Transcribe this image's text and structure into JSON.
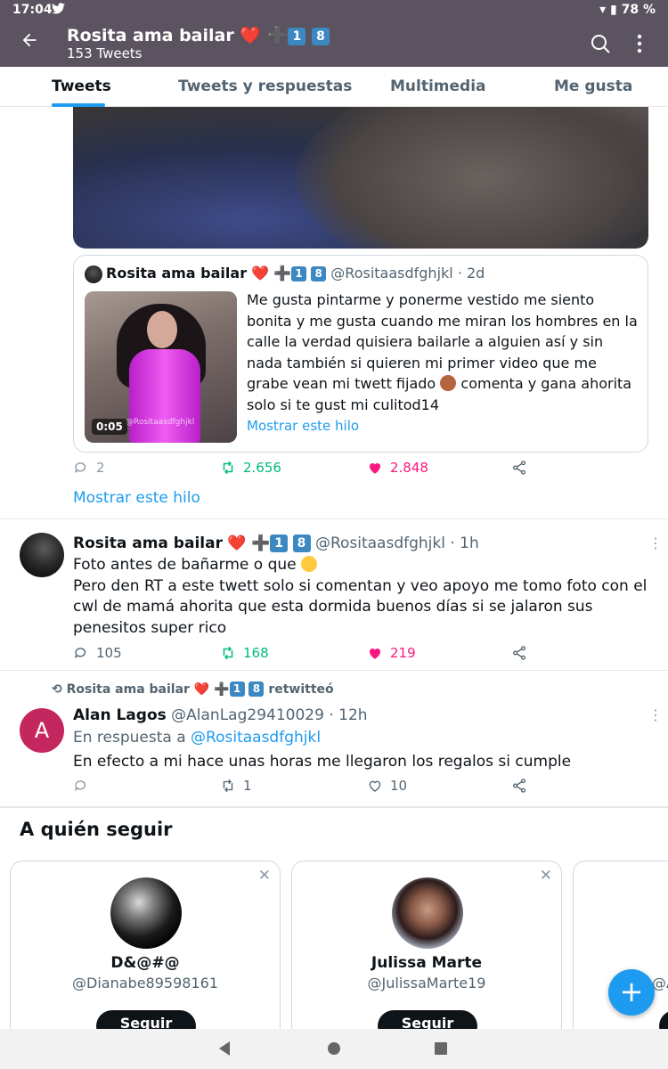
{
  "status_bar": {
    "time": "17:04",
    "battery": "78 %"
  },
  "header": {
    "name": "Rosita ama bailar",
    "name_digits": [
      "1",
      "8"
    ],
    "subtitle": "153 Tweets"
  },
  "tabs": [
    "Tweets",
    "Tweets y respuestas",
    "Multimedia",
    "Me gusta"
  ],
  "quoted_tweet": {
    "name": "Rosita ama bailar",
    "handle": "@Rositaasdfghjkl",
    "time": "· 2d",
    "text": "Me gusta pintarme y ponerme vestido me siento bonita y me gusta cuando me miran los hombres en la calle la verdad quisiera bailarle a alguien así y sin nada también si quieren mi primer video que me grabe vean mi twett fijado",
    "text_end": "comenta y gana ahorita solo si te gust mi culitod14",
    "video_duration": "0:05",
    "video_watermark": "@Rositaasdfghjkl",
    "show_thread": "Mostrar este hilo"
  },
  "tweet1_actions": {
    "replies": "2",
    "retweets": "2.656",
    "likes": "2.848"
  },
  "show_thread": "Mostrar este hilo",
  "tweet2": {
    "name": "Rosita ama bailar",
    "handle": "@Rositaasdfghjkl",
    "time": "· 1h",
    "line1": "Foto antes de bañarme o que",
    "body": "Pero den RT a este twett solo si comentan y veo apoyo me tomo foto con el cwl de mamá ahorita que esta dormida buenos días si se jalaron sus penesitos  super rico",
    "replies": "105",
    "retweets": "168",
    "likes": "219"
  },
  "tweet3": {
    "retweeted_by": "Rosita ama bailar",
    "retweeted_suffix": "retwitteó",
    "avatar_letter": "A",
    "name": "Alan Lagos",
    "handle": "@AlanLag29410029",
    "time": "· 12h",
    "reply_prefix": "En respuesta a",
    "reply_handle": "@Rositaasdfghjkl",
    "body": "En efecto a mi hace unas horas me llegaron los regalos  si cumple",
    "replies": "",
    "retweets": "1",
    "likes": "10"
  },
  "who_to_follow": {
    "title": "A quién seguir",
    "follow_label": "Seguir",
    "cards": [
      {
        "name": "D&@#@",
        "handle": "@Dianabe89598161"
      },
      {
        "name": "Julissa Marte",
        "handle": "@JulissaMarte19"
      },
      {
        "name": "",
        "handle": "@Ar"
      }
    ]
  },
  "colors": {
    "accent": "#1d9bf0",
    "retweet": "#00ba7c",
    "like": "#f91880",
    "header_bg": "#5b5460"
  }
}
